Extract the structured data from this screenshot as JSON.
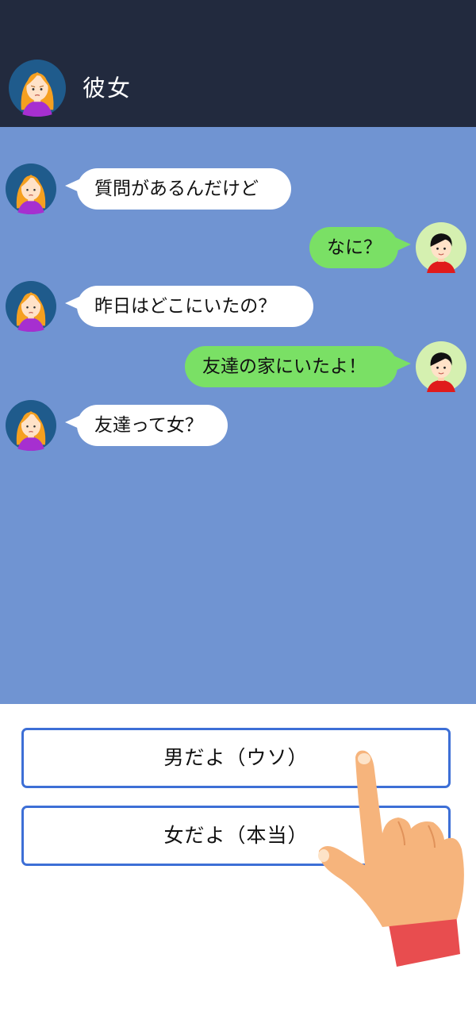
{
  "header": {
    "title": "彼女"
  },
  "messages": [
    {
      "side": "in",
      "text": "質問があるんだけど"
    },
    {
      "side": "out",
      "text": "なに？"
    },
    {
      "side": "in",
      "text": "昨日はどこにいたの？"
    },
    {
      "side": "out",
      "text": "友達の家にいたよ！"
    },
    {
      "side": "in",
      "text": "友達って女？"
    }
  ],
  "choices": [
    {
      "label": "男だよ（ウソ）"
    },
    {
      "label": "女だよ（本当）"
    }
  ],
  "colors": {
    "header_bg": "#222a3e",
    "chat_bg": "#7094d2",
    "bubble_in": "#ffffff",
    "bubble_out": "#7ae065",
    "choice_border": "#3d6fd6"
  },
  "icons": {
    "girlfriend_avatar": "girl-avatar-icon",
    "user_avatar": "boy-avatar-icon",
    "pointer": "pointing-hand-icon"
  }
}
